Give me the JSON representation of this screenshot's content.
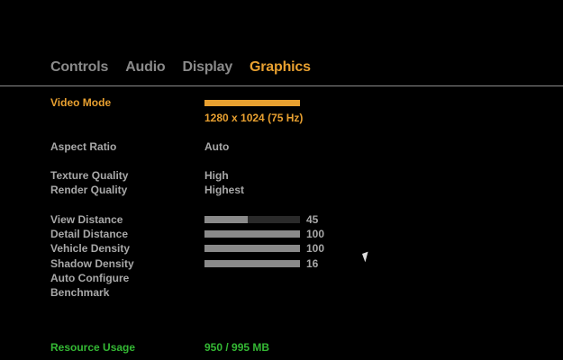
{
  "tabs": [
    {
      "label": "Controls",
      "active": false
    },
    {
      "label": "Audio",
      "active": false
    },
    {
      "label": "Display",
      "active": false
    },
    {
      "label": "Graphics",
      "active": true
    }
  ],
  "settings": {
    "video_mode": {
      "label": "Video Mode",
      "value": "1280 x 1024 (75 Hz)"
    },
    "aspect_ratio": {
      "label": "Aspect Ratio",
      "value": "Auto"
    },
    "texture_quality": {
      "label": "Texture Quality",
      "value": "High"
    },
    "render_quality": {
      "label": "Render Quality",
      "value": "Highest"
    },
    "view_distance": {
      "label": "View Distance",
      "value": "45",
      "fill_fraction": 0.45
    },
    "detail_distance": {
      "label": "Detail Distance",
      "value": "100",
      "fill_fraction": 1.0
    },
    "vehicle_density": {
      "label": "Vehicle Density",
      "value": "100",
      "fill_fraction": 1.0
    },
    "shadow_density": {
      "label": "Shadow Density",
      "value": "16",
      "fill_fraction": 1.0
    },
    "auto_configure": {
      "label": "Auto Configure"
    },
    "benchmark": {
      "label": "Benchmark"
    }
  },
  "resource_usage": {
    "label": "Resource Usage",
    "value": "950 / 995 MB"
  },
  "colors": {
    "accent": "#e8a030",
    "text": "#a8a8a8",
    "inactive_tab": "#8a8a8a",
    "resource": "#34b834",
    "background": "#000000"
  }
}
